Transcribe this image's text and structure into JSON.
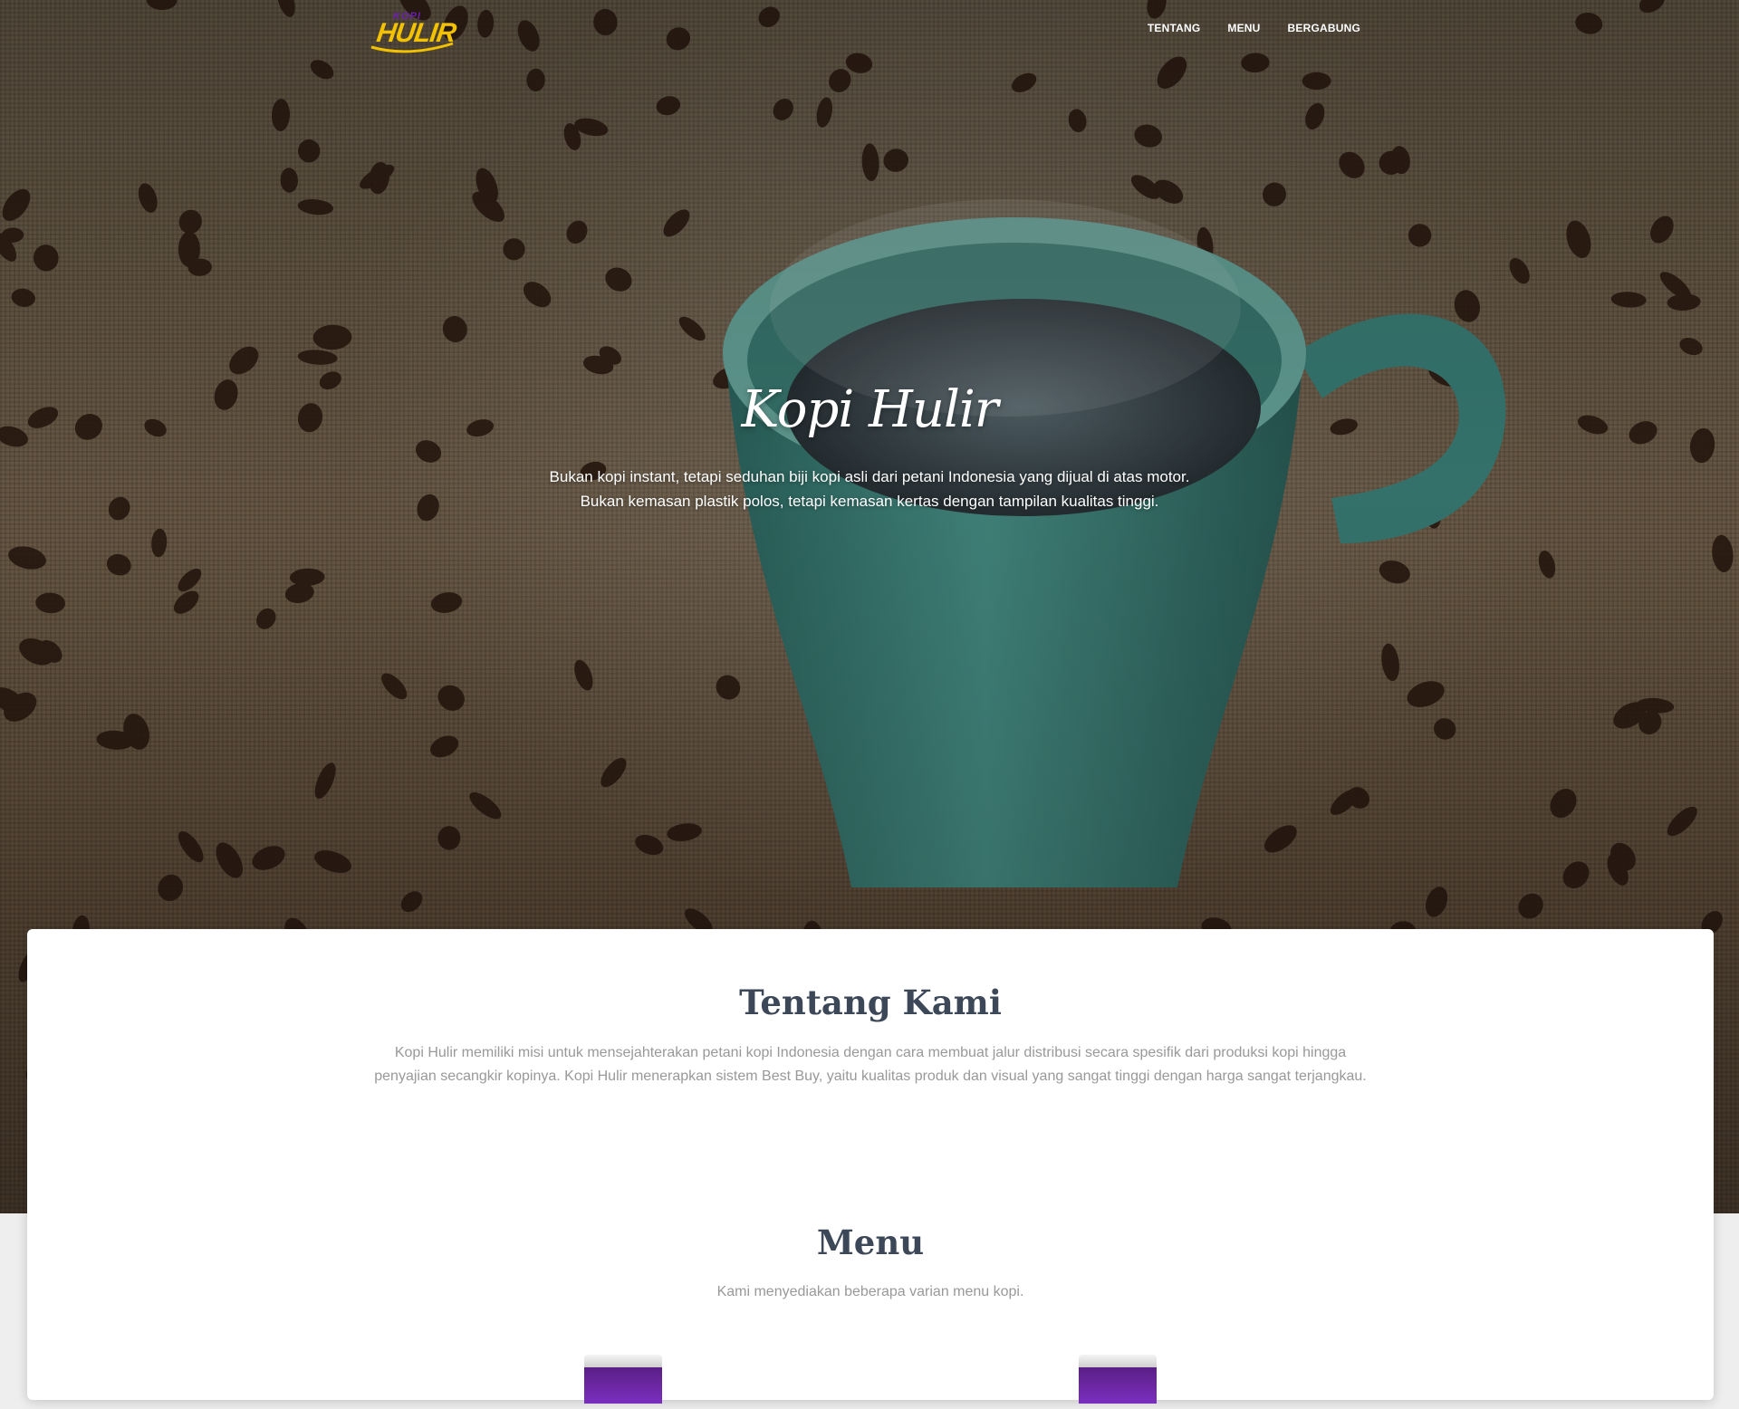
{
  "nav": {
    "logo_top": "KOPI",
    "logo_main": "HULIR",
    "links": [
      "TENTANG",
      "MENU",
      "BERGABUNG"
    ]
  },
  "hero": {
    "title": "Kopi Hulir",
    "subtitle_line1": "Bukan kopi instant, tetapi seduhan biji kopi asli dari petani Indonesia yang dijual di atas motor.",
    "subtitle_line2": "Bukan kemasan plastik polos, tetapi kemasan kertas dengan tampilan kualitas tinggi."
  },
  "about": {
    "title": "Tentang Kami",
    "text": "Kopi Hulir memiliki misi untuk mensejahterakan petani kopi Indonesia dengan cara membuat jalur distribusi secara spesifik dari produksi kopi hingga penyajian secangkir kopinya. Kopi Hulir menerapkan sistem Best Buy, yaitu kualitas produk dan visual yang sangat tinggi dengan harga sangat terjangkau."
  },
  "menu": {
    "title": "Menu",
    "description": "Kami menyediakan beberapa varian menu kopi."
  },
  "colors": {
    "logo_yellow": "#f2c100",
    "logo_purple": "#6d1fb0",
    "heading": "#3c4858",
    "body_text": "#999999",
    "cup_teal": "#3f8a82"
  }
}
